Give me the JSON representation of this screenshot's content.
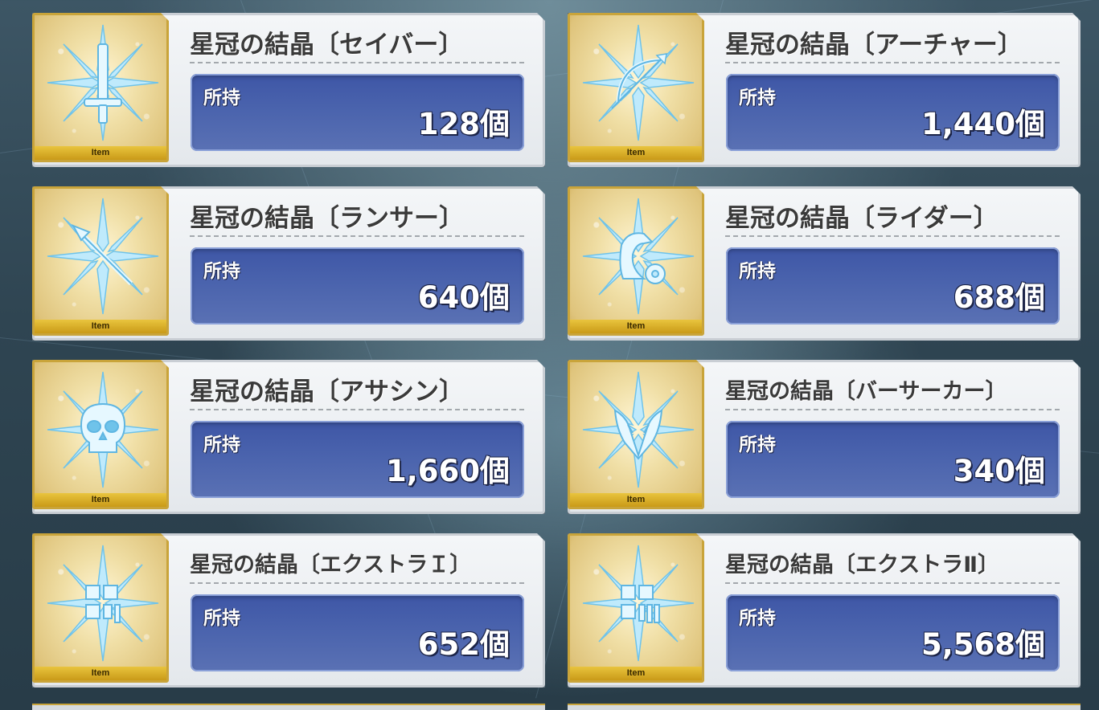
{
  "items": [
    {
      "title": "星冠の結晶〔セイバー〕",
      "owned_label": "所持",
      "owned_value": "128個",
      "tag": "Item",
      "icon": "saber-sword-crystal-icon"
    },
    {
      "title": "星冠の結晶〔アーチャー〕",
      "owned_label": "所持",
      "owned_value": "1,440個",
      "tag": "Item",
      "icon": "archer-bow-crystal-icon"
    },
    {
      "title": "星冠の結晶〔ランサー〕",
      "owned_label": "所持",
      "owned_value": "640個",
      "tag": "Item",
      "icon": "lancer-spear-crystal-icon"
    },
    {
      "title": "星冠の結晶〔ライダー〕",
      "owned_label": "所持",
      "owned_value": "688個",
      "tag": "Item",
      "icon": "rider-horse-crystal-icon"
    },
    {
      "title": "星冠の結晶〔アサシン〕",
      "owned_label": "所持",
      "owned_value": "1,660個",
      "tag": "Item",
      "icon": "assassin-skull-crystal-icon"
    },
    {
      "title": "星冠の結晶〔バーサーカー〕",
      "owned_label": "所持",
      "owned_value": "340個",
      "tag": "Item",
      "icon": "berserker-beast-crystal-icon"
    },
    {
      "title": "星冠の結晶〔エクストラＩ〕",
      "owned_label": "所持",
      "owned_value": "652個",
      "tag": "Item",
      "icon": "extra-one-crystal-icon"
    },
    {
      "title": "星冠の結晶〔エクストラⅡ〕",
      "owned_label": "所持",
      "owned_value": "5,568個",
      "tag": "Item",
      "icon": "extra-two-crystal-icon"
    }
  ],
  "colors": {
    "owned_panel": "#4a63ad",
    "icon_frame_gold": "#c9a43a",
    "crystal": "#9fdcf5"
  }
}
